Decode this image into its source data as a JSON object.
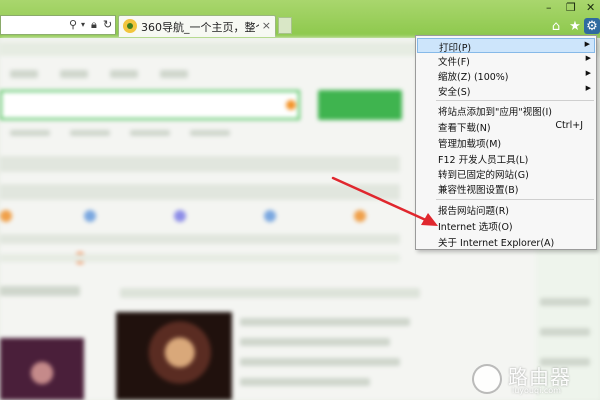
{
  "browser": {
    "tab_title": "360导航_一个主页，整个世...",
    "tab_close": "×",
    "window_buttons": {
      "minimize": "–",
      "maximize": "❐",
      "close": "✕"
    },
    "address_icons": [
      "search-icon",
      "dropdown-icon",
      "lock-icon",
      "refresh-icon"
    ],
    "toolbar_icons": [
      "home-icon",
      "star-icon",
      "gear-icon"
    ],
    "accent_color": "#8cc84b"
  },
  "tools_menu": {
    "items": [
      {
        "label": "打印(P)",
        "shortcut": "",
        "submenu": true,
        "highlighted": true
      },
      {
        "label": "文件(F)",
        "shortcut": "",
        "submenu": true,
        "highlighted": false
      },
      {
        "label": "缩放(Z) (100%)",
        "shortcut": "",
        "submenu": true,
        "highlighted": false
      },
      {
        "label": "安全(S)",
        "shortcut": "",
        "submenu": true,
        "highlighted": false
      },
      {
        "label": "将站点添加到\"应用\"视图(I)",
        "shortcut": "",
        "submenu": false,
        "highlighted": false
      },
      {
        "label": "查看下载(N)",
        "shortcut": "Ctrl+J",
        "submenu": false,
        "highlighted": false
      },
      {
        "label": "管理加载项(M)",
        "shortcut": "",
        "submenu": false,
        "highlighted": false
      },
      {
        "label": "F12 开发人员工具(L)",
        "shortcut": "",
        "submenu": false,
        "highlighted": false
      },
      {
        "label": "转到已固定的网站(G)",
        "shortcut": "",
        "submenu": false,
        "highlighted": false
      },
      {
        "label": "兼容性视图设置(B)",
        "shortcut": "",
        "submenu": false,
        "highlighted": false
      },
      {
        "label": "报告网站问题(R)",
        "shortcut": "",
        "submenu": false,
        "highlighted": false
      },
      {
        "label": "Internet 选项(O)",
        "shortcut": "",
        "submenu": false,
        "highlighted": false
      },
      {
        "label": "关于 Internet Explorer(A)",
        "shortcut": "",
        "submenu": false,
        "highlighted": false
      }
    ]
  },
  "annotation": {
    "arrow_color": "#e0272e"
  },
  "watermark": {
    "text_cn": "路由器",
    "text_en": "luyouqi.com"
  }
}
